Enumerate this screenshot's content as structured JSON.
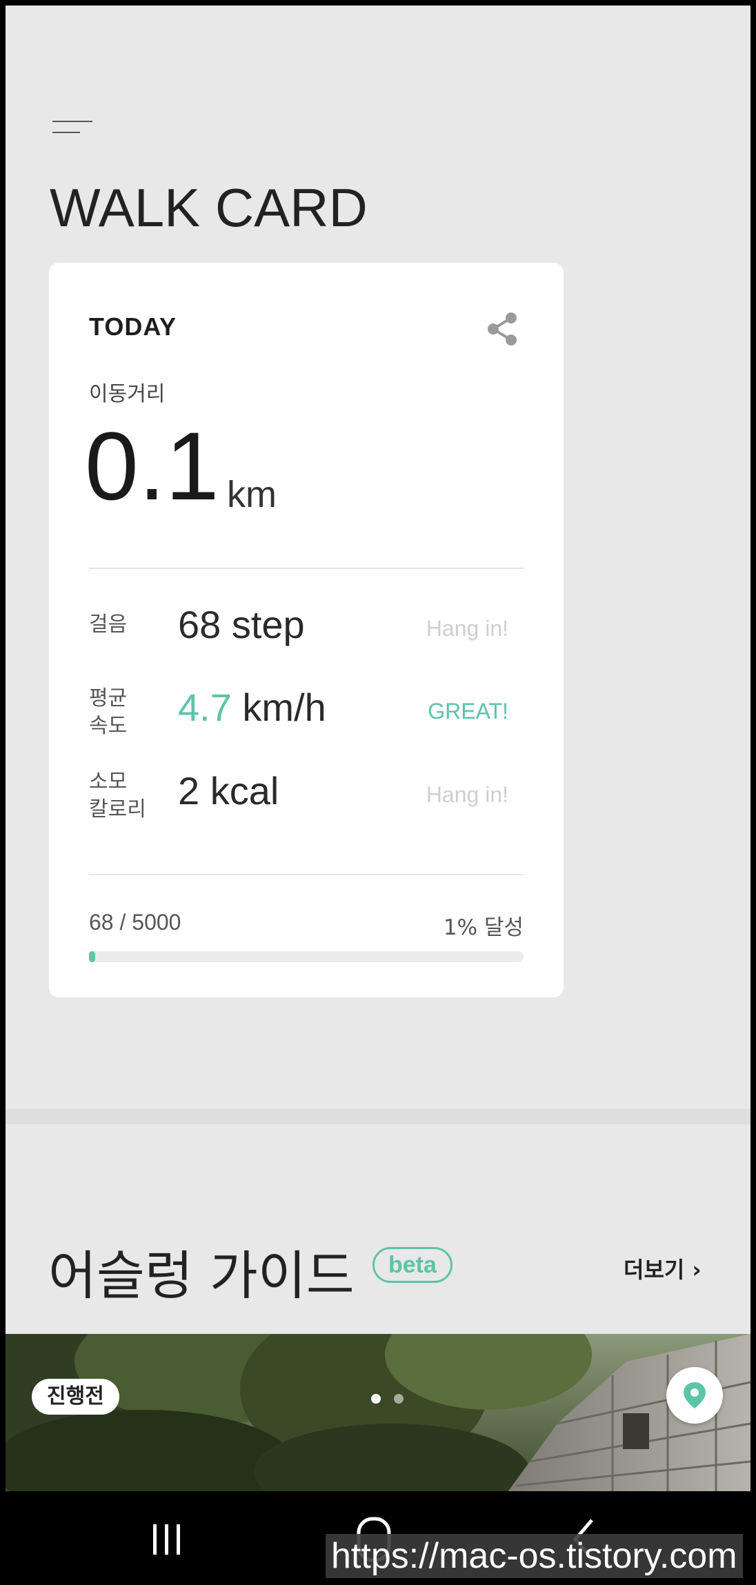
{
  "header": {
    "title": "WALK CARD",
    "menu_icon": "menu-icon"
  },
  "walk_card": {
    "period_label": "TODAY",
    "share_icon": "share-icon",
    "distance": {
      "label": "이동거리",
      "value": "0.1",
      "unit": "km"
    },
    "stats": [
      {
        "label_line1": "걸음",
        "label_line2": "",
        "value_accent": "",
        "value": "68 step",
        "status": "Hang in!"
      },
      {
        "label_line1": "평균",
        "label_line2": "속도",
        "value_accent": "4.7",
        "value": " km/h",
        "status": "GREAT!"
      },
      {
        "label_line1": "소모",
        "label_line2": "칼로리",
        "value_accent": "",
        "value": "2 kcal",
        "status": "Hang in!"
      }
    ],
    "progress": {
      "text": "68 / 5000",
      "achieved": "1% 달성",
      "fraction": 0.0136
    }
  },
  "guide": {
    "title": "어슬렁 가이드",
    "badge": "beta",
    "more_label": "더보기 ›",
    "card": {
      "status": "진행전",
      "page_count": 2,
      "active_page": 0,
      "map_icon": "location-pin-icon"
    }
  },
  "colors": {
    "accent": "#5cc4a7",
    "background": "#e8e8e8"
  },
  "system_nav": {
    "recents_icon": "recents-icon",
    "home_icon": "home-icon",
    "back_icon": "back-icon"
  },
  "watermark": "https://mac-os.tistory.com"
}
